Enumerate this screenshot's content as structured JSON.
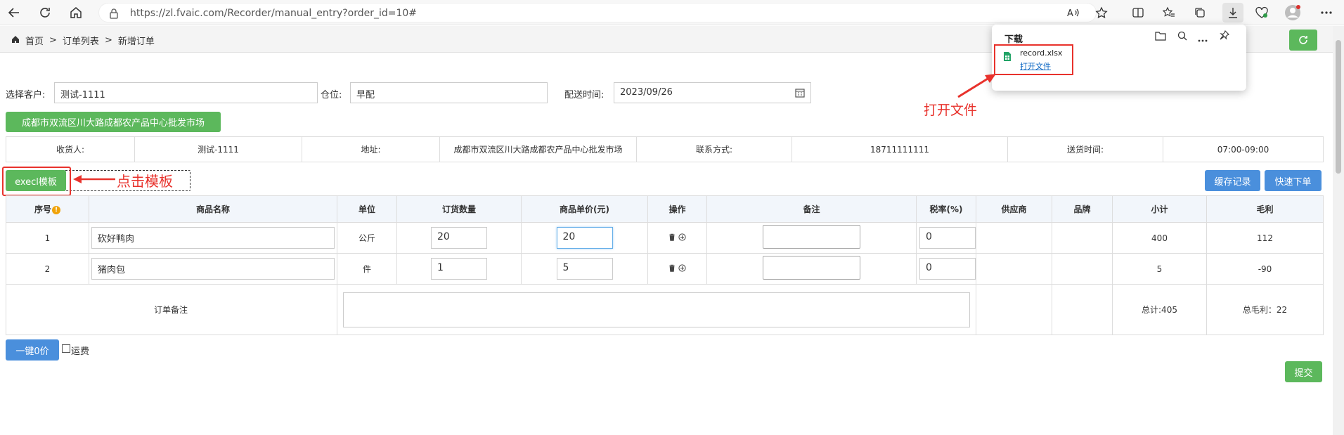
{
  "browser": {
    "url": "https://zl.fvaic.com/Recorder/manual_entry?order_id=10#"
  },
  "breadcrumb": {
    "home": "首页",
    "sep": ">",
    "list": "订单列表",
    "current": "新增订单"
  },
  "form": {
    "customer_label": "选择客户:",
    "customer_value": "测试-1111",
    "warehouse_label": "仓位:",
    "warehouse_value": "早配",
    "delivery_label": "配送时间:",
    "delivery_value": "2023/09/26",
    "address_button": "成都市双流区川大路成都农产品中心批发市场"
  },
  "info_row": {
    "receiver_label": "收货人:",
    "receiver_value": "测试-1111",
    "address_label": "地址:",
    "address_value": "成都市双流区川大路成都农产品中心批发市场",
    "contact_label": "联系方式:",
    "contact_value": "18711111111",
    "time_label": "送货时间:",
    "time_value": "07:00-09:00"
  },
  "toolbar": {
    "excel_button": "execl模板",
    "cache_button": "缓存记录",
    "quick_order_button": "快速下单",
    "annotation_click": "点击模板"
  },
  "table": {
    "headers": [
      "序号",
      "商品名称",
      "单位",
      "订货数量",
      "商品单价(元)",
      "操作",
      "备注",
      "税率(%)",
      "供应商",
      "品牌",
      "小计",
      "毛利"
    ],
    "rows": [
      {
        "no": "1",
        "name": "砍好鸭肉",
        "unit": "公斤",
        "qty": "20",
        "price": "20",
        "tax": "0",
        "subtotal": "400",
        "profit": "112"
      },
      {
        "no": "2",
        "name": "猪肉包",
        "unit": "件",
        "qty": "1",
        "price": "5",
        "tax": "0",
        "subtotal": "5",
        "profit": "-90"
      }
    ],
    "order_note_label": "订单备注",
    "total": "总计:405",
    "total_profit": "总毛利：22"
  },
  "footer": {
    "zero_price_button": "一键0价",
    "freight_label": "运费",
    "submit_button": "提交"
  },
  "download_panel": {
    "title": "下载",
    "file_name": "record.xlsx",
    "open_link": "打开文件",
    "annotation_open": "打开文件"
  },
  "colors": {
    "green": "#5cb85c",
    "blue": "#4a8fdc",
    "annotation_red": "#e8322c"
  }
}
